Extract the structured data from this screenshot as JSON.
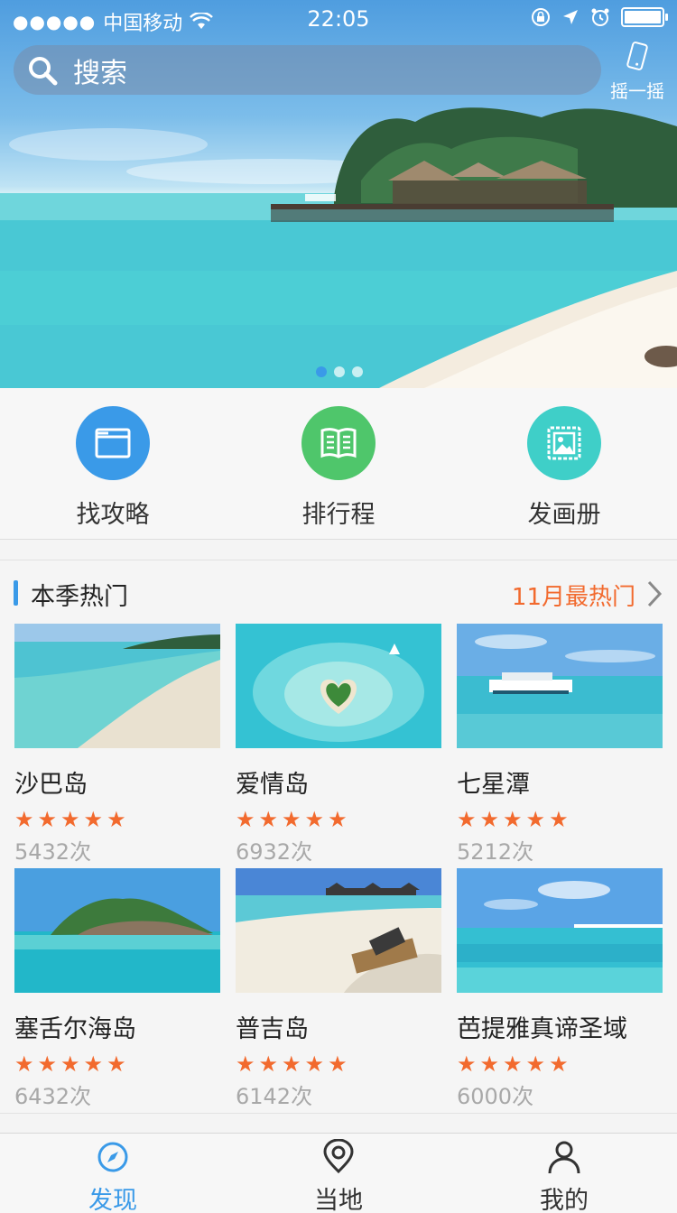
{
  "status_bar": {
    "signal": "●●●●●",
    "carrier": "中国移动",
    "time": "22:05"
  },
  "search": {
    "placeholder": "搜索",
    "shake_label": "摇一摇"
  },
  "banner": {
    "page_count": 3,
    "active_page": 1
  },
  "quick_actions": [
    {
      "label": "找攻略",
      "icon": "folder-icon",
      "color": "#3a9ae8"
    },
    {
      "label": "排行程",
      "icon": "book-icon",
      "color": "#4fc66b"
    },
    {
      "label": "发画册",
      "icon": "picture-icon",
      "color": "#3fcfc8"
    }
  ],
  "hot": {
    "title": "本季热门",
    "more": "11月最热门",
    "items": [
      {
        "name": "沙巴岛",
        "stars": "★★★★★",
        "count": "5432次"
      },
      {
        "name": "爱情岛",
        "stars": "★★★★★",
        "count": "6932次"
      },
      {
        "name": "七星潭",
        "stars": "★★★★★",
        "count": "5212次"
      },
      {
        "name": "塞舌尔海岛",
        "stars": "★★★★★",
        "count": "6432次"
      },
      {
        "name": "普吉岛",
        "stars": "★★★★★",
        "count": "6142次"
      },
      {
        "name": "芭提雅真谛圣域",
        "stars": "★★★★★",
        "count": "6000次"
      }
    ]
  },
  "tabbar": {
    "items": [
      {
        "label": "发现",
        "icon": "compass-icon"
      },
      {
        "label": "当地",
        "icon": "location-pin-icon"
      },
      {
        "label": "我的",
        "icon": "person-icon"
      }
    ],
    "active": "发现"
  },
  "colors": {
    "accent": "#3a9ae8",
    "hot_accent": "#f26a2e",
    "muted": "#a8a8a8"
  }
}
